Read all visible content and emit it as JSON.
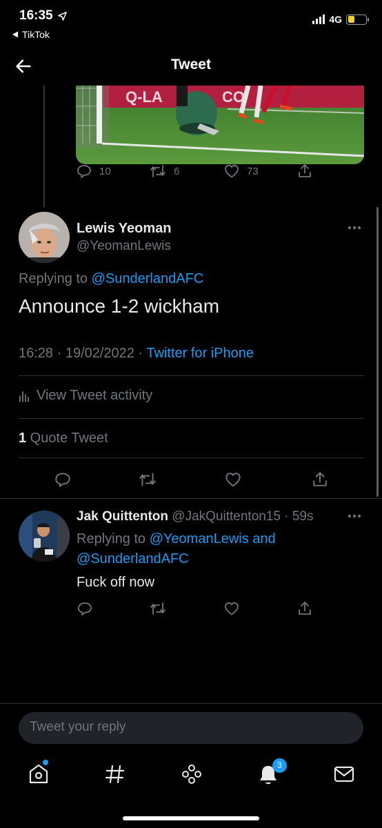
{
  "status_bar": {
    "time": "16:35",
    "back_app": "TikTok",
    "network": "4G",
    "battery_level": 0.38,
    "battery_color": "#f7d21b"
  },
  "header": {
    "title": "Tweet"
  },
  "media_tweet": {
    "reply_count": "10",
    "retweet_count": "6",
    "like_count": "73",
    "banner_text": "Q-LA"
  },
  "main_tweet": {
    "name": "Lewis Yeoman",
    "handle": "@YeomanLewis",
    "replying_prefix": "Replying to ",
    "replying_to": "@SunderlandAFC",
    "text": "Announce 1-2 wickham",
    "timestamp": "16:28 · 19/02/2022 · ",
    "source": "Twitter for iPhone",
    "view_activity": "View Tweet activity",
    "quote_count": "1",
    "quote_label": " Quote Tweet"
  },
  "reply_tweet": {
    "name": "Jak Quittenton",
    "handle_time": "@JakQuittenton15 · 59s",
    "replying_prefix": "Replying to ",
    "replying_to_1": "@YeomanLewis",
    "replying_and": " and",
    "replying_to_2": "@SunderlandAFC",
    "text": "Fuck off now"
  },
  "reply_bar": {
    "placeholder": "Tweet your reply"
  },
  "tabs": {
    "notifications_badge": "3",
    "items": [
      "home-icon",
      "explore-icon",
      "spaces-icon",
      "notifications-icon",
      "messages-icon"
    ]
  },
  "colors": {
    "accent": "#1d9bf0",
    "background": "#000000",
    "muted": "#71767b"
  }
}
